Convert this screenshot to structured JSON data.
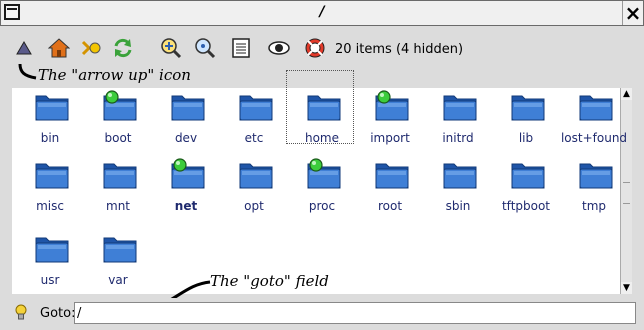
{
  "window": {
    "title": "/",
    "close_glyph": "×"
  },
  "toolbar": {
    "items_status": "20 items (4 hidden)",
    "icons": [
      "arrow-up-icon",
      "home-icon",
      "bookmarks-icon",
      "refresh-icon",
      "zoom-in-icon",
      "zoom-out-icon",
      "details-view-icon",
      "show-hidden-icon",
      "help-icon"
    ]
  },
  "annotations": {
    "arrow_up": "The \"arrow up\" icon",
    "goto": "The \"goto\" field"
  },
  "files": [
    {
      "name": "bin",
      "mount": false,
      "bold": false
    },
    {
      "name": "boot",
      "mount": true,
      "bold": false
    },
    {
      "name": "dev",
      "mount": false,
      "bold": false
    },
    {
      "name": "etc",
      "mount": false,
      "bold": false
    },
    {
      "name": "home",
      "mount": false,
      "bold": false,
      "selected": true
    },
    {
      "name": "import",
      "mount": true,
      "bold": false
    },
    {
      "name": "initrd",
      "mount": false,
      "bold": false
    },
    {
      "name": "lib",
      "mount": false,
      "bold": false
    },
    {
      "name": "lost+found",
      "mount": false,
      "bold": false
    },
    {
      "name": "misc",
      "mount": false,
      "bold": false
    },
    {
      "name": "mnt",
      "mount": false,
      "bold": false
    },
    {
      "name": "net",
      "mount": true,
      "bold": true
    },
    {
      "name": "opt",
      "mount": false,
      "bold": false
    },
    {
      "name": "proc",
      "mount": true,
      "bold": false
    },
    {
      "name": "root",
      "mount": false,
      "bold": false
    },
    {
      "name": "sbin",
      "mount": false,
      "bold": false
    },
    {
      "name": "tftpboot",
      "mount": false,
      "bold": false
    },
    {
      "name": "tmp",
      "mount": false,
      "bold": false
    },
    {
      "name": "usr",
      "mount": false,
      "bold": false
    },
    {
      "name": "var",
      "mount": false,
      "bold": false
    }
  ],
  "goto": {
    "label": "Goto:",
    "value": "/"
  },
  "colors": {
    "folder": "#3f7fd6",
    "folder_dark": "#1f55a8",
    "mount_dot": "#3ccc3c",
    "filename": "#1f2a6e"
  }
}
